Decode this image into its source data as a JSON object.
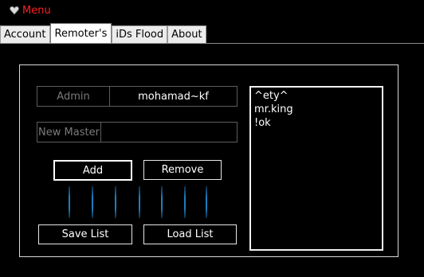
{
  "menu": {
    "label": "Menu",
    "icon": "heart-icon",
    "label_color": "#ff2020"
  },
  "tabs": [
    {
      "label": "Account",
      "active": false
    },
    {
      "label": "Remoter's",
      "active": true
    },
    {
      "label": "iDs Flood",
      "active": false
    },
    {
      "label": "About",
      "active": false
    }
  ],
  "admin_field": {
    "label": "Admin",
    "value": "mohamad~kf"
  },
  "new_master_field": {
    "label": "New Master",
    "value": ""
  },
  "buttons": {
    "add": "Add",
    "remove": "Remove",
    "save_list": "Save List",
    "load_list": "Load List"
  },
  "master_list": [
    "^ety^",
    "mr.king",
    "!ok"
  ],
  "colors": {
    "background": "#000000",
    "accent_bar": "#1e7ec0"
  }
}
